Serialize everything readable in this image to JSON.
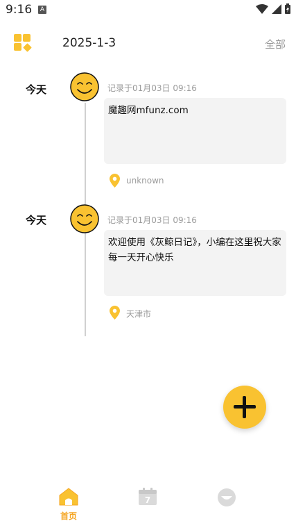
{
  "status_bar": {
    "time": "9:16",
    "notification_letter": "A"
  },
  "header": {
    "date": "2025-1-3",
    "filter_label": "全部"
  },
  "entries": [
    {
      "day": "今天",
      "record_time": "记录于01月03日 09:16",
      "content": "魔趣网mfunz.com",
      "location": "unknown"
    },
    {
      "day": "今天",
      "record_time": "记录于01月03日 09:16",
      "content": "欢迎使用《灰鲸日记》，小编在这里祝大家每一天开心快乐",
      "location": "天津市"
    }
  ],
  "bottom_nav": {
    "home_label": "首页",
    "calendar_day": "7"
  },
  "colors": {
    "accent": "#f9c231",
    "nav_active": "#f5a623",
    "card_bg": "#f3f3f3",
    "muted_text": "#9b9b9b"
  }
}
